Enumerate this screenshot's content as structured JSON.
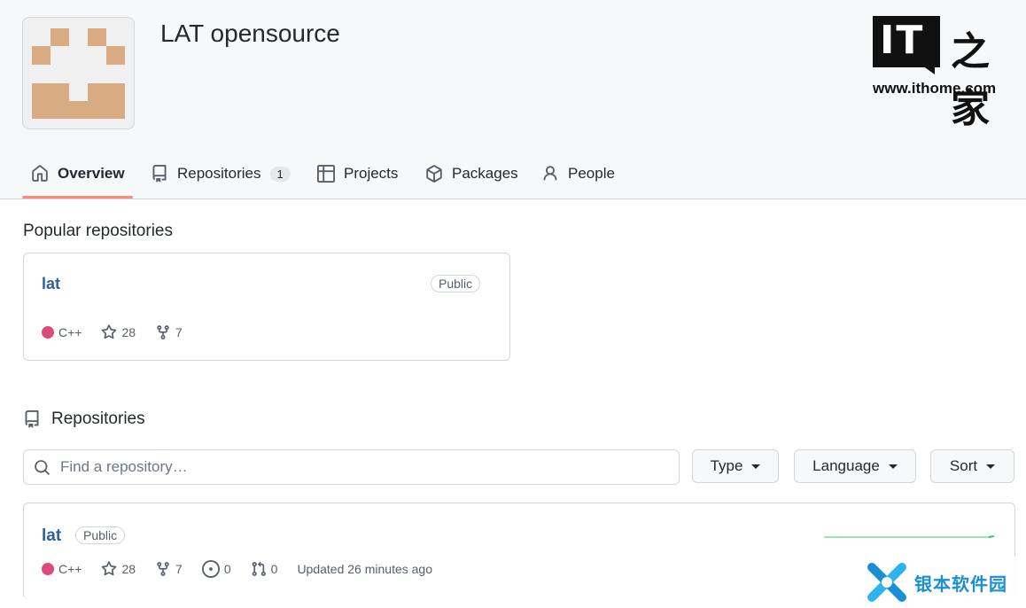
{
  "org": {
    "name": "LAT opensource"
  },
  "watermark_top": {
    "logo_text": "IT",
    "logo_chars": "之家",
    "url": "www.ithome.com"
  },
  "nav": {
    "tabs": [
      {
        "label": "Overview",
        "icon": "home-icon",
        "active": true
      },
      {
        "label": "Repositories",
        "icon": "repo-icon",
        "count": "1"
      },
      {
        "label": "Projects",
        "icon": "table-icon"
      },
      {
        "label": "Packages",
        "icon": "package-icon"
      },
      {
        "label": "People",
        "icon": "person-icon"
      }
    ]
  },
  "popular": {
    "title": "Popular repositories",
    "card": {
      "name": "lat",
      "visibility": "Public",
      "language": "C++",
      "stars": "28",
      "forks": "7"
    }
  },
  "repositories": {
    "title": "Repositories",
    "search_placeholder": "Find a repository…",
    "filters": {
      "type": "Type",
      "language": "Language",
      "sort": "Sort"
    },
    "items": [
      {
        "name": "lat",
        "visibility": "Public",
        "language": "C++",
        "stars": "28",
        "forks": "7",
        "issues": "0",
        "pulls": "0",
        "updated": "Updated 26 minutes ago"
      }
    ]
  },
  "watermark_bottom": {
    "text": "银本软件园"
  },
  "colors": {
    "accent_underline": "#fd8c73",
    "link": "#2f5f9d",
    "cpp_dot": "#db4a78",
    "avatar": "#d9ab82"
  }
}
